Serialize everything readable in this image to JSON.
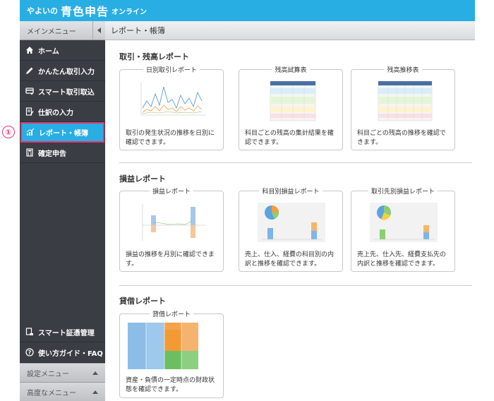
{
  "header": {
    "brand_prefix": "やよいの",
    "brand_main": "青色申告",
    "brand_suffix": "オンライン"
  },
  "sidebar": {
    "title": "メインメニュー",
    "items": [
      {
        "label": "ホーム"
      },
      {
        "label": "かんたん取引入力"
      },
      {
        "label": "スマート取引取込"
      },
      {
        "label": "仕訳の入力"
      },
      {
        "label": "レポート・帳簿"
      },
      {
        "label": "確定申告"
      }
    ],
    "bottom_items": [
      {
        "label": "スマート証憑管理"
      },
      {
        "label": "使い方ガイド・FAQ"
      }
    ],
    "sub_menus": [
      {
        "label": "設定メニュー"
      },
      {
        "label": "高度なメニュー"
      }
    ]
  },
  "annotation": {
    "marker": "①"
  },
  "page": {
    "title": "レポート・帳簿"
  },
  "sections": [
    {
      "title": "取引・残高レポート",
      "cards": [
        {
          "title": "日別取引レポート",
          "desc": "取引の発生状況の推移を日別に確認できます。"
        },
        {
          "title": "残高試算表",
          "desc": "科目ごとの残高の集計結果を確認できます。"
        },
        {
          "title": "残高推移表",
          "desc": "科目ごとの残高の推移を確認できます。"
        }
      ]
    },
    {
      "title": "損益レポート",
      "cards": [
        {
          "title": "損益レポート",
          "desc": "損益の推移を月別に確認できます。"
        },
        {
          "title": "科目別損益レポート",
          "desc": "売上、仕入、経費の科目別の内訳と推移を確認できます。"
        },
        {
          "title": "取引先別損益レポート",
          "desc": "売上先、仕入先、経費支払先の内訳と推移を確認できます。"
        }
      ]
    },
    {
      "title": "貸借レポート",
      "cards": [
        {
          "title": "貸借レポート",
          "desc": "資産・負債の一定時点の財政状態を確認できます。"
        }
      ]
    }
  ],
  "colors": {
    "header_blue": "#29aee4",
    "sidebar_dark": "#3a3d44",
    "highlight_pink": "#e5336e"
  }
}
